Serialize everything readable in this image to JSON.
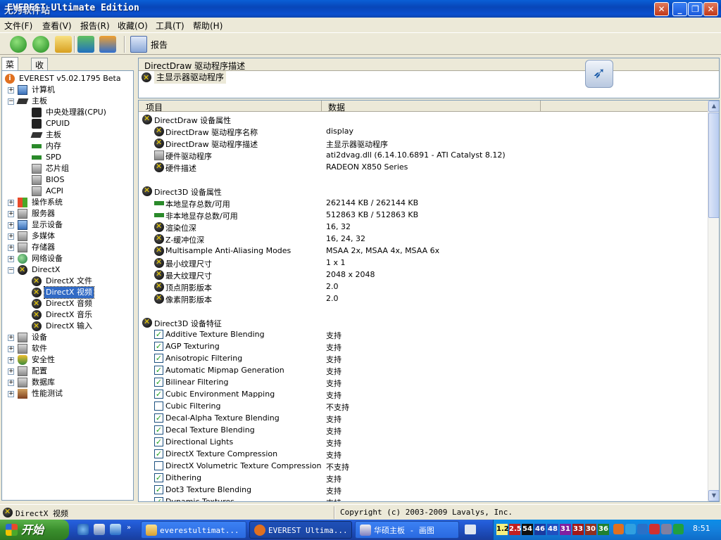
{
  "window": {
    "title": "EVEREST Ultimate Edition",
    "title_overlay": "无为软件站"
  },
  "menu": [
    {
      "label": "文件(F)"
    },
    {
      "label": "查看(V)"
    },
    {
      "label": "报告(R)"
    },
    {
      "label": "收藏(O)"
    },
    {
      "label": "工具(T)"
    },
    {
      "label": "帮助(H)"
    }
  ],
  "toolbar": {
    "report_label": "报告"
  },
  "tabs": [
    {
      "label": "菜单"
    },
    {
      "label": "收藏夹"
    }
  ],
  "tree": {
    "root": "EVEREST v5.02.1795 Beta",
    "items": [
      {
        "label": "计算机"
      },
      {
        "label": "主板"
      },
      {
        "label": "中央处理器(CPU)"
      },
      {
        "label": "CPUID"
      },
      {
        "label": "主板"
      },
      {
        "label": "内存"
      },
      {
        "label": "SPD"
      },
      {
        "label": "芯片组"
      },
      {
        "label": "BIOS"
      },
      {
        "label": "ACPI"
      },
      {
        "label": "操作系统"
      },
      {
        "label": "服务器"
      },
      {
        "label": "显示设备"
      },
      {
        "label": "多媒体"
      },
      {
        "label": "存储器"
      },
      {
        "label": "网络设备"
      },
      {
        "label": "DirectX"
      },
      {
        "label": "DirectX 文件"
      },
      {
        "label": "DirectX 视频"
      },
      {
        "label": "DirectX 音频"
      },
      {
        "label": "DirectX 音乐"
      },
      {
        "label": "DirectX 输入"
      },
      {
        "label": "设备"
      },
      {
        "label": "软件"
      },
      {
        "label": "安全性"
      },
      {
        "label": "配置"
      },
      {
        "label": "数据库"
      },
      {
        "label": "性能测试"
      }
    ]
  },
  "header": {
    "title": "DirectDraw 驱动程序描述",
    "device": "主显示器驱动程序"
  },
  "grid": {
    "col_item": "项目",
    "col_data": "数据",
    "sections": [
      {
        "title": "DirectDraw 设备属性",
        "rows": [
          {
            "field": "DirectDraw 驱动程序名称",
            "value": "display"
          },
          {
            "field": "DirectDraw 驱动程序描述",
            "value": "主显示器驱动程序"
          },
          {
            "field": "硬件驱动程序",
            "value": "ati2dvag.dll (6.14.10.6891 - ATI Catalyst 8.12)"
          },
          {
            "field": "硬件描述",
            "value": "RADEON X850 Series"
          }
        ]
      },
      {
        "title": "Direct3D 设备属性",
        "rows": [
          {
            "field": "本地显存总数/可用",
            "value": "262144 KB / 262144 KB"
          },
          {
            "field": "非本地显存总数/可用",
            "value": "512863 KB / 512863 KB"
          },
          {
            "field": "渲染位深",
            "value": "16, 32"
          },
          {
            "field": "Z-缓冲位深",
            "value": "16, 24, 32"
          },
          {
            "field": "Multisample Anti-Aliasing Modes",
            "value": "MSAA 2x, MSAA 4x, MSAA 6x"
          },
          {
            "field": "最小纹理尺寸",
            "value": "1 x 1"
          },
          {
            "field": "最大纹理尺寸",
            "value": "2048 x 2048"
          },
          {
            "field": "顶点阴影版本",
            "value": "2.0"
          },
          {
            "field": "像素阴影版本",
            "value": "2.0"
          }
        ]
      },
      {
        "title": "Direct3D 设备特征",
        "rows": [
          {
            "field": "Additive Texture Blending",
            "value": "支持",
            "checked": true
          },
          {
            "field": "AGP Texturing",
            "value": "支持",
            "checked": true
          },
          {
            "field": "Anisotropic Filtering",
            "value": "支持",
            "checked": true
          },
          {
            "field": "Automatic Mipmap Generation",
            "value": "支持",
            "checked": true
          },
          {
            "field": "Bilinear Filtering",
            "value": "支持",
            "checked": true
          },
          {
            "field": "Cubic Environment Mapping",
            "value": "支持",
            "checked": true
          },
          {
            "field": "Cubic Filtering",
            "value": "不支持",
            "checked": false
          },
          {
            "field": "Decal-Alpha Texture Blending",
            "value": "支持",
            "checked": true
          },
          {
            "field": "Decal Texture Blending",
            "value": "支持",
            "checked": true
          },
          {
            "field": "Directional Lights",
            "value": "支持",
            "checked": true
          },
          {
            "field": "DirectX Texture Compression",
            "value": "支持",
            "checked": true
          },
          {
            "field": "DirectX Volumetric Texture Compression",
            "value": "不支持",
            "checked": false
          },
          {
            "field": "Dithering",
            "value": "支持",
            "checked": true
          },
          {
            "field": "Dot3 Texture Blending",
            "value": "支持",
            "checked": true
          },
          {
            "field": "Dynamic Textures",
            "value": "支持",
            "checked": true
          }
        ]
      }
    ]
  },
  "status": {
    "left": "DirectX 视频",
    "right": "Copyright (c) 2003-2009 Lavalys, Inc."
  },
  "taskbar": {
    "start": "开始",
    "tasks": [
      {
        "label": "everestultimat..."
      },
      {
        "label": "EVEREST Ultima..."
      },
      {
        "label": "华硕主板 - 画图"
      }
    ],
    "tray_numbers": [
      "1.2",
      "2.5",
      "54",
      "46",
      "48",
      "31",
      "33",
      "30",
      "36"
    ],
    "clock": "8:51"
  }
}
